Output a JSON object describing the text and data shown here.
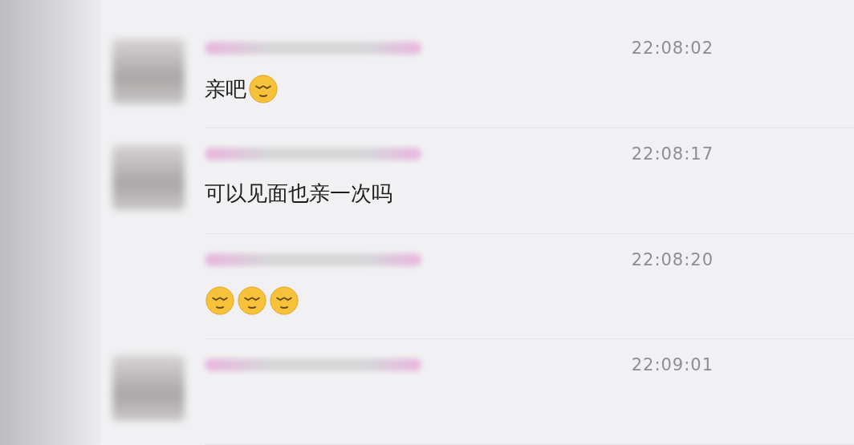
{
  "messages": [
    {
      "avatar": true,
      "time": "22:08:02",
      "content": [
        {
          "kind": "text",
          "text": "亲吧"
        },
        {
          "kind": "emoji"
        }
      ]
    },
    {
      "avatar": true,
      "time": "22:08:17",
      "content": [
        {
          "kind": "text",
          "text": "可以见面也亲一次吗"
        }
      ]
    },
    {
      "avatar": false,
      "time": "22:08:20",
      "content": [
        {
          "kind": "emoji"
        },
        {
          "kind": "emoji"
        },
        {
          "kind": "emoji"
        }
      ]
    },
    {
      "avatar": true,
      "time": "22:09:01"
    }
  ]
}
